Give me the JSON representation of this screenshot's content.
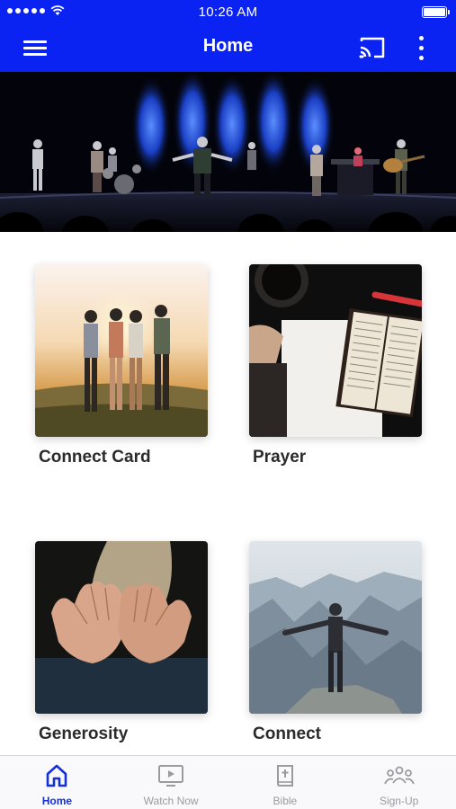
{
  "status_bar": {
    "time": "10:26 AM"
  },
  "app_bar": {
    "title": "Home"
  },
  "cards": [
    {
      "label": "Connect Card"
    },
    {
      "label": "Prayer"
    },
    {
      "label": "Generosity"
    },
    {
      "label": "Connect"
    }
  ],
  "tabs": [
    {
      "label": "Home",
      "icon": "home-icon",
      "active": true
    },
    {
      "label": "Watch Now",
      "icon": "tv-play-icon",
      "active": false
    },
    {
      "label": "Bible",
      "icon": "bible-icon",
      "active": false
    },
    {
      "label": "Sign-Up",
      "icon": "group-icon",
      "active": false
    }
  ],
  "colors": {
    "brand": "#0a22f2",
    "active_tab": "#1530d8",
    "inactive_tab": "#9a9aa0"
  }
}
